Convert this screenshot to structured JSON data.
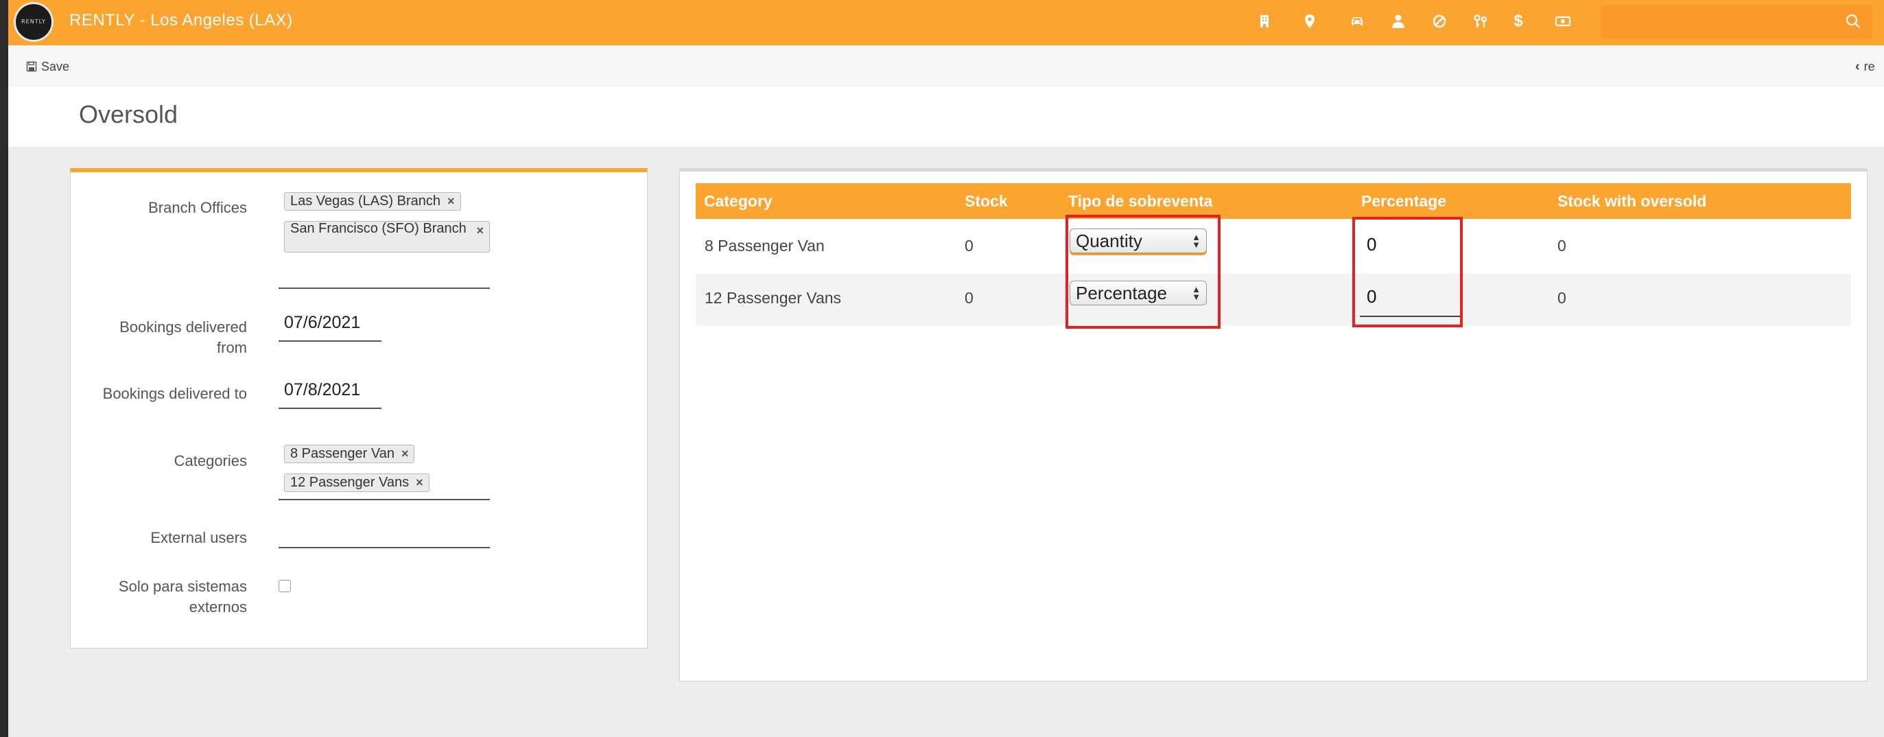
{
  "app": {
    "logo_text": "RENTLY",
    "title": "RENTLY - Los Angeles (LAX)"
  },
  "topbar_icons": [
    "building-icon",
    "location-pin-icon",
    "car-icon",
    "user-icon",
    "block-icon",
    "keys-icon",
    "dollar-icon",
    "cash-icon"
  ],
  "search": {
    "placeholder": ""
  },
  "toolbar": {
    "save_label": "Save",
    "return_label": "re"
  },
  "page": {
    "title": "Oversold"
  },
  "form": {
    "branch_label": "Branch Offices",
    "branches": [
      "Las Vegas (LAS) Branch",
      "San Francisco (SFO) Branch"
    ],
    "from_label": "Bookings delivered from",
    "from_value": "07/6/2021",
    "to_label": "Bookings delivered to",
    "to_value": "07/8/2021",
    "categories_label": "Categories",
    "categories": [
      "8 Passenger Van",
      "12 Passenger Vans"
    ],
    "external_users_label": "External users",
    "solo_label": "Solo para sistemas externos",
    "solo_checked": false
  },
  "table": {
    "headers": [
      "Category",
      "Stock",
      "Tipo de sobreventa",
      "Percentage",
      "Stock with oversold"
    ],
    "rows": [
      {
        "category": "8 Passenger Van",
        "stock": "0",
        "tipo": "Quantity",
        "percentage": "0",
        "stock_oversold": "0"
      },
      {
        "category": "12 Passenger Vans",
        "stock": "0",
        "tipo": "Percentage",
        "percentage": "0",
        "stock_oversold": "0"
      }
    ]
  },
  "colors": {
    "brand": "#fca430",
    "highlight": "#e62121"
  }
}
